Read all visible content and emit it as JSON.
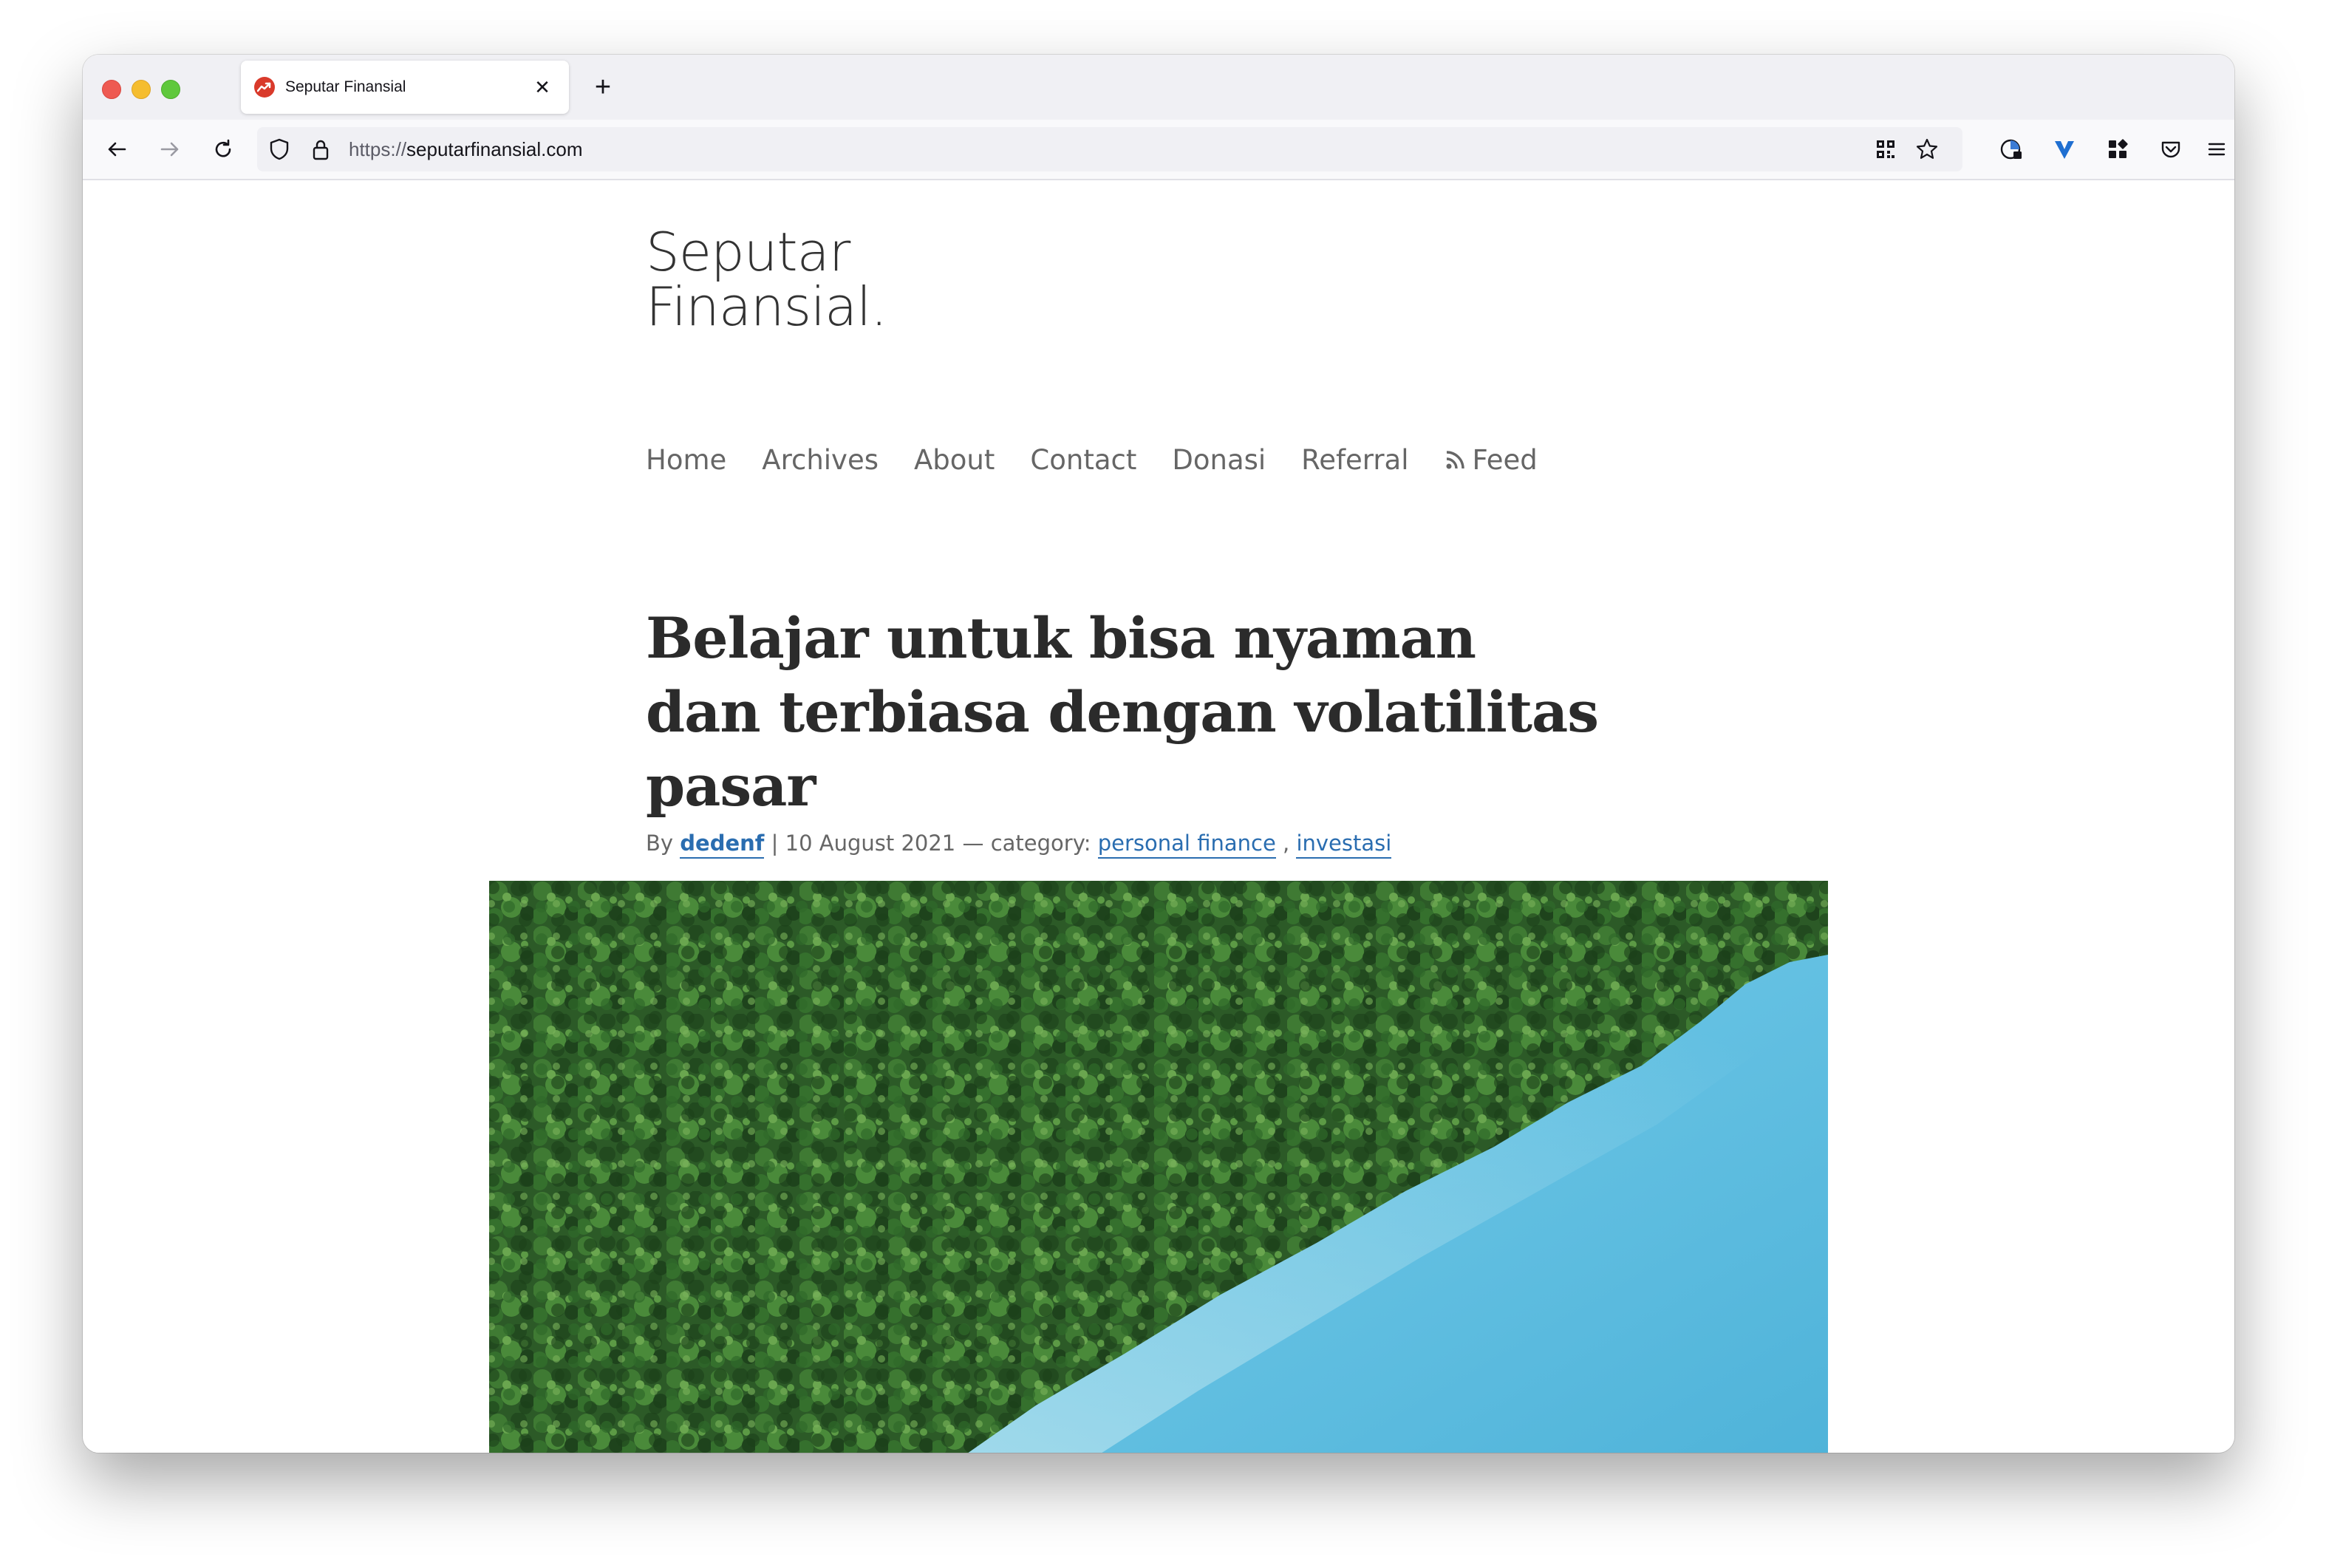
{
  "browser": {
    "tab_title": "Seputar Finansial",
    "tab_close": "✕",
    "new_tab": "+",
    "url_scheme": "https://",
    "url_host": "seputarfinansial.com"
  },
  "site": {
    "title_line1": "Seputar",
    "title_line2": "Finansial."
  },
  "nav": {
    "home": "Home",
    "archives": "Archives",
    "about": "About",
    "contact": "Contact",
    "donasi": "Donasi",
    "referral": "Referral",
    "feed": "Feed"
  },
  "post": {
    "title": "Belajar untuk bisa nyaman dan terbiasa dengan volatilitas pasar",
    "by": "By",
    "author": "dedenf",
    "separator": " | ",
    "date": "10 August 2021",
    "category_prefix": " — category: ",
    "category1": "personal finance",
    "category_sep": " , ",
    "category2": "investasi"
  },
  "colors": {
    "link": "#2a6db0",
    "favicon": "#d93a2b",
    "forest": "#2e5e2a",
    "water": "#5dbfe0"
  }
}
